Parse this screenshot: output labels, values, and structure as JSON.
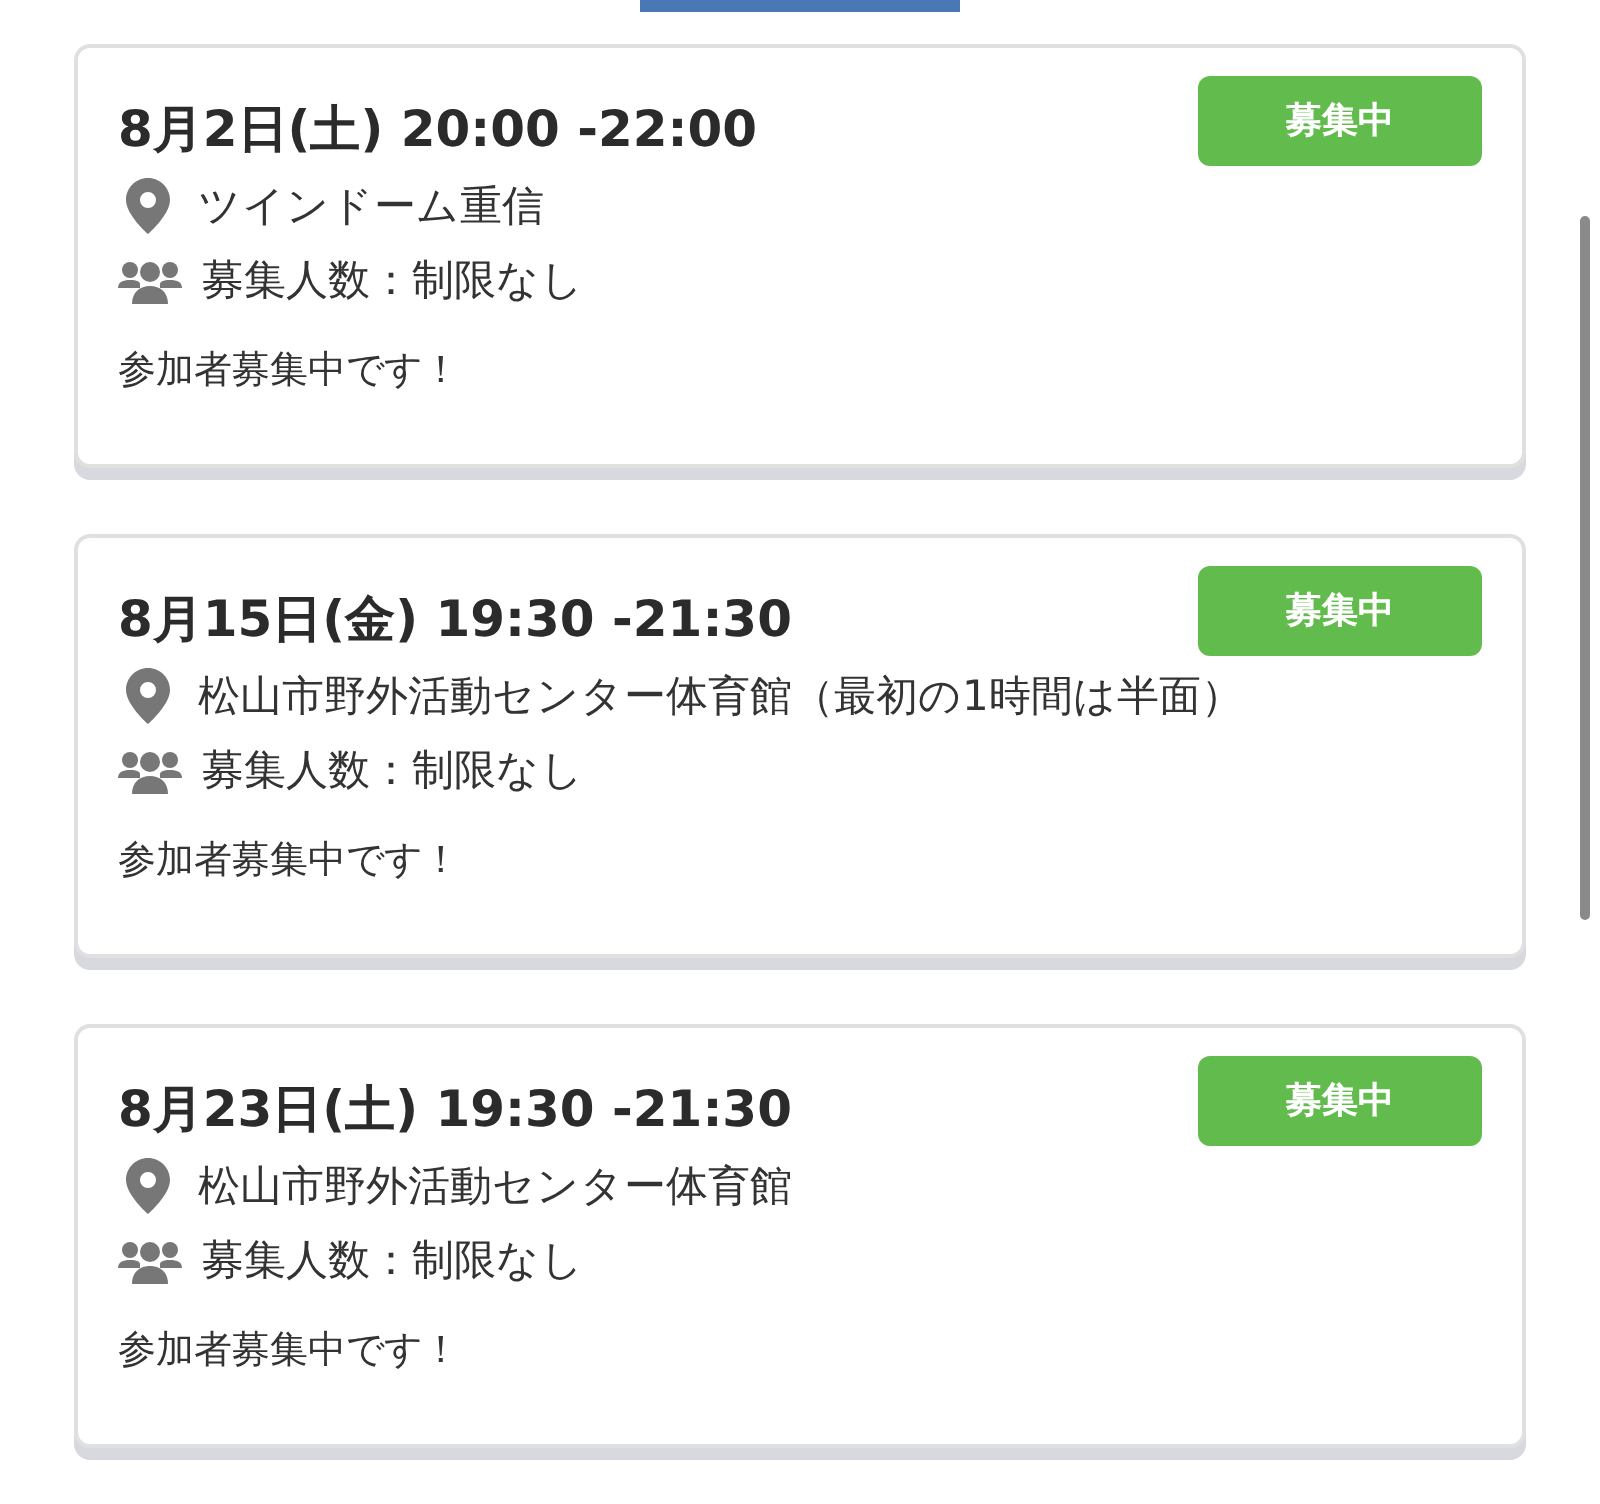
{
  "events": [
    {
      "datetime": "8月2日(土) 20:00 -22:00",
      "status": "募集中",
      "location": "ツインドーム重信",
      "capacity": "募集人数：制限なし",
      "note": "参加者募集中です！"
    },
    {
      "datetime": "8月15日(金) 19:30 -21:30",
      "status": "募集中",
      "location": "松山市野外活動センター体育館（最初の1時間は半面）",
      "capacity": "募集人数：制限なし",
      "note": "参加者募集中です！"
    },
    {
      "datetime": "8月23日(土) 19:30 -21:30",
      "status": "募集中",
      "location": "松山市野外活動センター体育館",
      "capacity": "募集人数：制限なし",
      "note": "参加者募集中です！"
    }
  ]
}
